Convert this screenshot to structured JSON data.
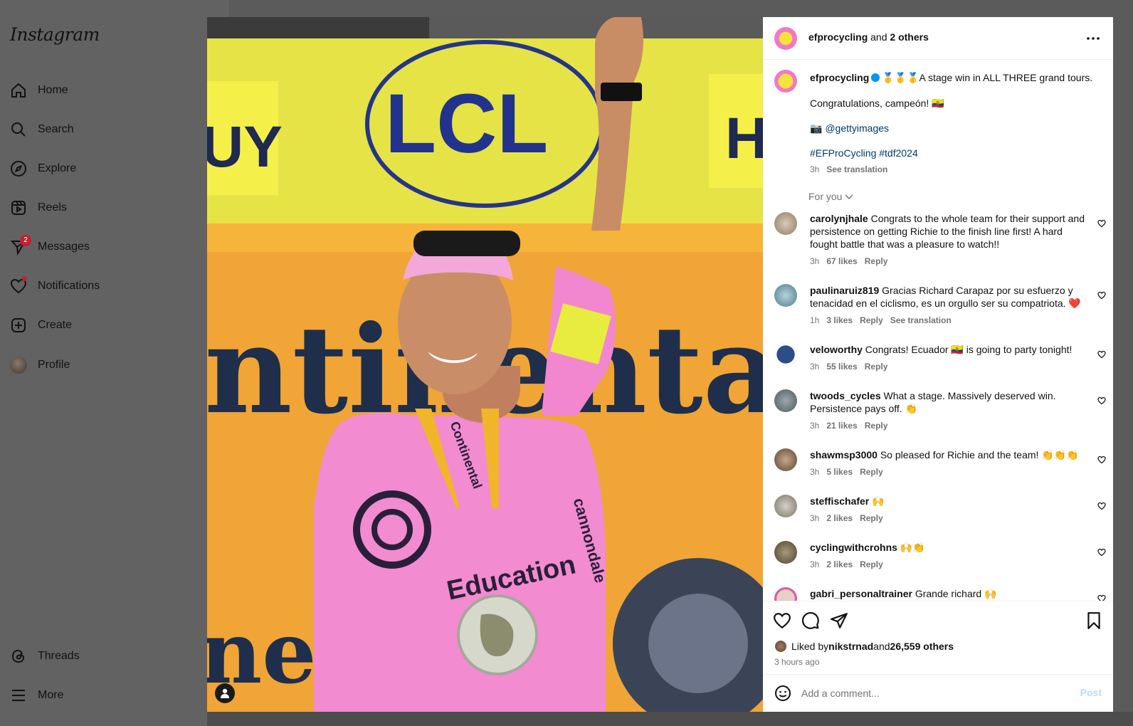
{
  "sidebar": {
    "logo": "Instagram",
    "items": [
      {
        "label": "Home",
        "icon": "home-icon"
      },
      {
        "label": "Search",
        "icon": "search-icon"
      },
      {
        "label": "Explore",
        "icon": "compass-icon"
      },
      {
        "label": "Reels",
        "icon": "reels-icon"
      },
      {
        "label": "Messages",
        "icon": "messenger-icon",
        "badge": "2"
      },
      {
        "label": "Notifications",
        "icon": "heart-icon"
      },
      {
        "label": "Create",
        "icon": "plus-square-icon"
      },
      {
        "label": "Profile",
        "icon": "avatar"
      }
    ],
    "bottom": [
      {
        "label": "Threads",
        "icon": "threads-icon"
      },
      {
        "label": "More",
        "icon": "hamburger-icon"
      }
    ]
  },
  "post": {
    "header": {
      "user": "efprocycling",
      "and": " and ",
      "others": "2 others"
    },
    "caption": {
      "user": "efprocycling",
      "emoji": "🥇🥇🥇",
      "line1": "A stage win in ALL THREE grand tours.",
      "line2": "Congratulations, campeón! 🇪🇨",
      "camera": "📷",
      "mention": "@gettyimages",
      "hashtags": "#EFProCycling #tdf2024",
      "time": "3h",
      "see_translation": "See translation"
    },
    "for_you": "For you",
    "comments": [
      {
        "user": "carolynjhale",
        "text": "Congrats to the whole team for their support and persistence on getting Richie to the finish line first! A hard fought battle that was a pleasure to watch!!",
        "time": "3h",
        "likes": "67 likes",
        "reply": "Reply"
      },
      {
        "user": "paulinaruiz819",
        "text": "Gracias Richard Carapaz por su esfuerzo y tenacidad en el ciclismo, es un orgullo ser su compatriota. ❤️",
        "time": "1h",
        "likes": "3 likes",
        "reply": "Reply",
        "translation": "See translation"
      },
      {
        "user": "veloworthy",
        "text": "Congrats! Ecuador 🇪🇨 is going to party tonight!",
        "time": "3h",
        "likes": "55 likes",
        "reply": "Reply"
      },
      {
        "user": "twoods_cycles",
        "text": "What a stage. Massively deserved win. Persistence pays off. 👏",
        "time": "3h",
        "likes": "21 likes",
        "reply": "Reply"
      },
      {
        "user": "shawmsp3000",
        "text": "So pleased for Richie and the team! 👏👏👏",
        "time": "3h",
        "likes": "5 likes",
        "reply": "Reply"
      },
      {
        "user": "steffischafer",
        "text": "🙌",
        "time": "3h",
        "likes": "2 likes",
        "reply": "Reply"
      },
      {
        "user": "cyclingwithcrohns",
        "text": "🙌👏",
        "time": "3h",
        "likes": "2 likes",
        "reply": "Reply"
      },
      {
        "user": "gabri_personaltrainer",
        "text": "Grande richard 🙌",
        "time": "",
        "likes": "",
        "reply": ""
      }
    ],
    "liked_by": {
      "prefix": "Liked by ",
      "user": "nikstrnad",
      "and": " and ",
      "others": "26,559 others"
    },
    "posted_ago": "3 hours ago",
    "add_comment_placeholder": "Add a comment...",
    "post_button": "Post"
  },
  "image": {
    "sponsor_top": "LCL",
    "sponsor_main": "ntinental",
    "banner_left": "UY",
    "banner_right": "H",
    "jersey_text": "Education",
    "jersey_side": "cannondale",
    "lanyard": "Continental"
  },
  "colors": {
    "accent": "#0095f6",
    "link": "#00376b",
    "badge": "#c41e32",
    "jersey": "#f28bd0",
    "banner": "#e9e44a"
  }
}
